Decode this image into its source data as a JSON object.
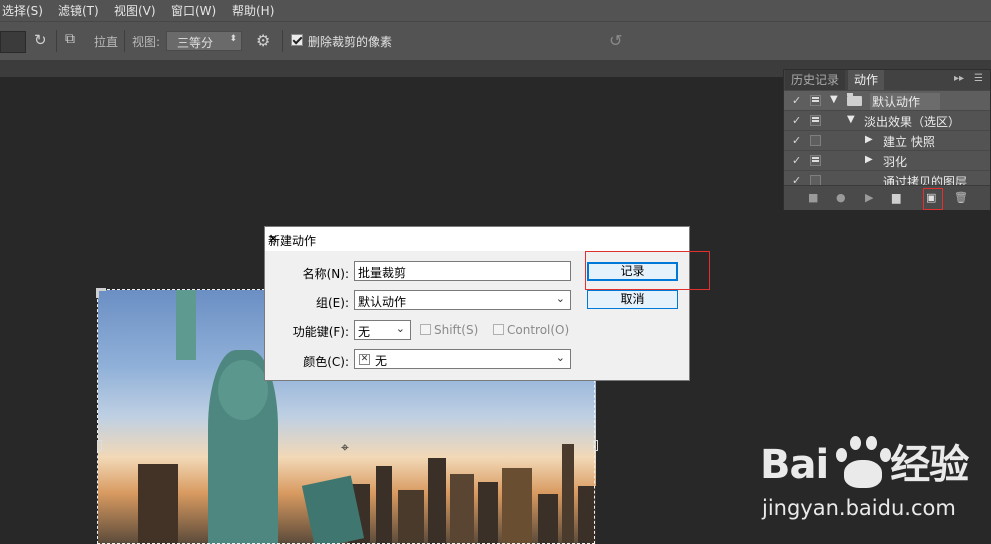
{
  "menubar": {
    "items": [
      "选择(S)",
      "滤镜(T)",
      "视图(V)",
      "窗口(W)",
      "帮助(H)"
    ]
  },
  "options": {
    "straighten_label": "拉直",
    "view_label": "视图:",
    "view_value": "三等分",
    "delete_cropped_label": "删除裁剪的像素",
    "delete_cropped_checked": true
  },
  "panel": {
    "tabs": [
      "历史记录",
      "动作"
    ],
    "active_tab": "动作",
    "rows": [
      {
        "label": "默认动作",
        "expanded": true,
        "folder": true,
        "selected": true
      },
      {
        "label": "淡出效果（选区）",
        "expanded": true,
        "folder": false
      },
      {
        "label": "建立 快照",
        "expanded": false,
        "folder": false
      },
      {
        "label": "羽化",
        "expanded": false,
        "folder": false
      },
      {
        "label": "通过拷贝的图层",
        "expanded": false,
        "folder": false
      }
    ]
  },
  "dialog": {
    "title": "新建动作",
    "name_label": "名称(N):",
    "name_value": "批量裁剪",
    "group_label": "组(E):",
    "group_value": "默认动作",
    "function_key_label": "功能键(F):",
    "function_key_value": "无",
    "shift_label": "Shift(S)",
    "control_label": "Control(O)",
    "color_label": "颜色(C):",
    "color_value": "无",
    "record_button": "记录",
    "cancel_button": "取消"
  },
  "watermark": {
    "logo_left": "Bai",
    "logo_right": "经验",
    "url": "jingyan.baidu.com"
  },
  "colors": {
    "highlight_red": "#e03030",
    "focus_blue": "#0078d7",
    "panel_bg": "#535353"
  }
}
